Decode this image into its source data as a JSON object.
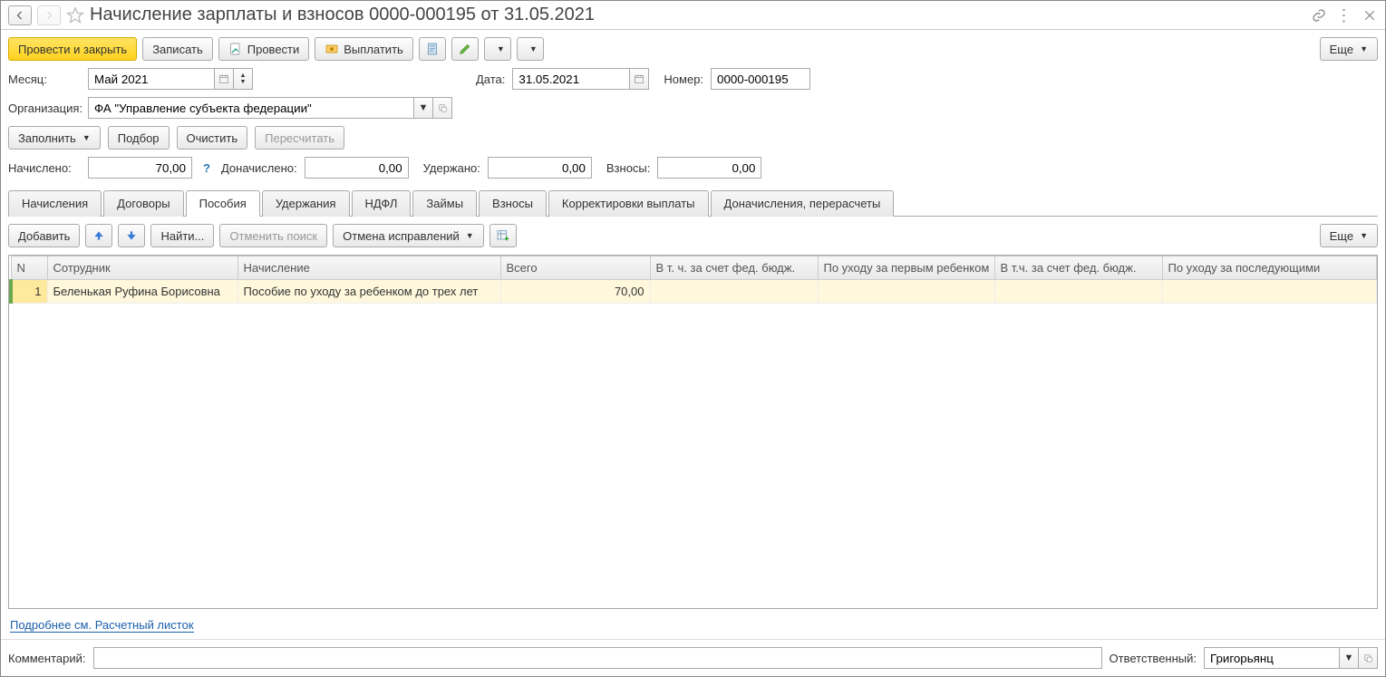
{
  "title": "Начисление зарплаты и взносов 0000-000195 от 31.05.2021",
  "toolbar": {
    "post_close": "Провести и закрыть",
    "save": "Записать",
    "post": "Провести",
    "pay": "Выплатить",
    "more": "Еще"
  },
  "fields": {
    "month_label": "Месяц:",
    "month_value": "Май 2021",
    "date_label": "Дата:",
    "date_value": "31.05.2021",
    "number_label": "Номер:",
    "number_value": "0000-000195",
    "org_label": "Организация:",
    "org_value": "ФА \"Управление субъекта федерации\""
  },
  "actions": {
    "fill": "Заполнить",
    "pick": "Подбор",
    "clear": "Очистить",
    "recalc": "Пересчитать"
  },
  "totals": {
    "accrued_label": "Начислено:",
    "accrued_value": "70,00",
    "additional_label": "Доначислено:",
    "additional_value": "0,00",
    "withheld_label": "Удержано:",
    "withheld_value": "0,00",
    "contrib_label": "Взносы:",
    "contrib_value": "0,00"
  },
  "tabs": [
    "Начисления",
    "Договоры",
    "Пособия",
    "Удержания",
    "НДФЛ",
    "Займы",
    "Взносы",
    "Корректировки выплаты",
    "Доначисления, перерасчеты"
  ],
  "active_tab": "Пособия",
  "subtoolbar": {
    "add": "Добавить",
    "find": "Найти...",
    "cancel_search": "Отменить поиск",
    "cancel_fix": "Отмена исправлений",
    "more": "Еще"
  },
  "columns": [
    "N",
    "Сотрудник",
    "Начисление",
    "Всего",
    "В т. ч. за счет фед. бюдж.",
    "По уходу за первым ребенком",
    "В т.ч. за счет фед. бюдж.",
    "По уходу за последующими"
  ],
  "rows": [
    {
      "n": "1",
      "employee": "Беленькая Руфина Борисовна",
      "accrual": "Пособие по уходу за ребенком до трех лет",
      "total": "70,00",
      "fed1": "",
      "first": "",
      "fed2": "",
      "next": ""
    }
  ],
  "link": "Подробнее см. Расчетный листок",
  "footer": {
    "comment_label": "Комментарий:",
    "comment_value": "",
    "responsible_label": "Ответственный:",
    "responsible_value": "Григорьянц"
  }
}
